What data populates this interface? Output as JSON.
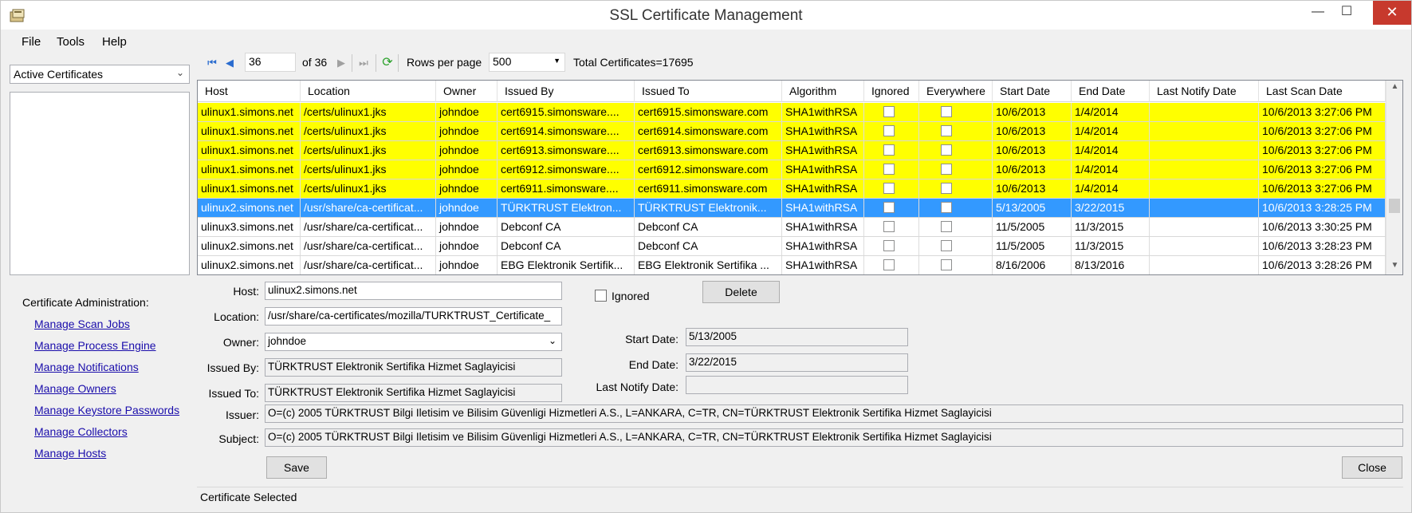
{
  "window": {
    "title": "SSL Certificate Management",
    "min_glyph": "—",
    "max_glyph": "☐",
    "close_glyph": "✕"
  },
  "menu": {
    "file": "File",
    "tools": "Tools",
    "help": "Help"
  },
  "toolbar": {
    "page_value": "36",
    "of_text": "of 36",
    "rows_per_page_label": "Rows per page",
    "rows_per_page_value": "500",
    "total_text": "Total Certificates=17695"
  },
  "sidebar": {
    "filter_value": "Active Certificates",
    "admin_title": "Certificate Administration:",
    "links": [
      "Manage Scan Jobs",
      "Manage Process Engine",
      "Manage Notifications",
      "Manage Owners",
      "Manage Keystore Passwords",
      "Manage Collectors",
      "Manage Hosts"
    ]
  },
  "grid": {
    "columns": [
      "Host",
      "Location",
      "Owner",
      "Issued By",
      "Issued To",
      "Algorithm",
      "Ignored",
      "Everywhere",
      "Start Date",
      "End Date",
      "Last Notify Date",
      "Last Scan Date"
    ],
    "rows": [
      [
        "ulinux1.simons.net",
        "/certs/ulinux1.jks",
        "johndoe",
        "cert6915.simonsware....",
        "cert6915.simonsware.com",
        "SHA1withRSA",
        "",
        "",
        "10/6/2013",
        "1/4/2014",
        "",
        "10/6/2013 3:27:06 PM"
      ],
      [
        "ulinux1.simons.net",
        "/certs/ulinux1.jks",
        "johndoe",
        "cert6914.simonsware....",
        "cert6914.simonsware.com",
        "SHA1withRSA",
        "",
        "",
        "10/6/2013",
        "1/4/2014",
        "",
        "10/6/2013 3:27:06 PM"
      ],
      [
        "ulinux1.simons.net",
        "/certs/ulinux1.jks",
        "johndoe",
        "cert6913.simonsware....",
        "cert6913.simonsware.com",
        "SHA1withRSA",
        "",
        "",
        "10/6/2013",
        "1/4/2014",
        "",
        "10/6/2013 3:27:06 PM"
      ],
      [
        "ulinux1.simons.net",
        "/certs/ulinux1.jks",
        "johndoe",
        "cert6912.simonsware....",
        "cert6912.simonsware.com",
        "SHA1withRSA",
        "",
        "",
        "10/6/2013",
        "1/4/2014",
        "",
        "10/6/2013 3:27:06 PM"
      ],
      [
        "ulinux1.simons.net",
        "/certs/ulinux1.jks",
        "johndoe",
        "cert6911.simonsware....",
        "cert6911.simonsware.com",
        "SHA1withRSA",
        "",
        "",
        "10/6/2013",
        "1/4/2014",
        "",
        "10/6/2013 3:27:06 PM"
      ],
      [
        "ulinux2.simons.net",
        "/usr/share/ca-certificat...",
        "johndoe",
        "TÜRKTRUST Elektron...",
        "TÜRKTRUST Elektronik...",
        "SHA1withRSA",
        "",
        "",
        "5/13/2005",
        "3/22/2015",
        "",
        "10/6/2013 3:28:25 PM"
      ],
      [
        "ulinux3.simons.net",
        "/usr/share/ca-certificat...",
        "johndoe",
        "Debconf CA",
        "Debconf CA",
        "SHA1withRSA",
        "",
        "",
        "11/5/2005",
        "11/3/2015",
        "",
        "10/6/2013 3:30:25 PM"
      ],
      [
        "ulinux2.simons.net",
        "/usr/share/ca-certificat...",
        "johndoe",
        "Debconf CA",
        "Debconf CA",
        "SHA1withRSA",
        "",
        "",
        "11/5/2005",
        "11/3/2015",
        "",
        "10/6/2013 3:28:23 PM"
      ],
      [
        "ulinux2.simons.net",
        "/usr/share/ca-certificat...",
        "johndoe",
        "EBG Elektronik Sertifik...",
        "EBG Elektronik Sertifika ...",
        "SHA1withRSA",
        "",
        "",
        "8/16/2006",
        "8/13/2016",
        "",
        "10/6/2013 3:28:26 PM"
      ]
    ],
    "row_styles": [
      "yellow",
      "yellow",
      "yellow",
      "yellow",
      "yellow",
      "sel",
      "",
      "",
      ""
    ]
  },
  "detail": {
    "host_label": "Host:",
    "host_value": "ulinux2.simons.net",
    "location_label": "Location:",
    "location_value": "/usr/share/ca-certificates/mozilla/TURKTRUST_Certificate_",
    "owner_label": "Owner:",
    "owner_value": "johndoe",
    "issued_by_label": "Issued By:",
    "issued_by_value": "TÜRKTRUST Elektronik Sertifika Hizmet Saglayicisi",
    "issued_to_label": "Issued To:",
    "issued_to_value": "TÜRKTRUST Elektronik Sertifika Hizmet Saglayicisi",
    "ignored_label": "Ignored",
    "delete_label": "Delete",
    "start_date_label": "Start Date:",
    "start_date_value": "5/13/2005",
    "end_date_label": "End Date:",
    "end_date_value": "3/22/2015",
    "last_notify_label": "Last Notify Date:",
    "last_notify_value": "",
    "issuer_label": "Issuer:",
    "issuer_value": "O=(c) 2005 TÜRKTRUST Bilgi Iletisim ve Bilisim Güvenligi Hizmetleri A.S., L=ANKARA, C=TR, CN=TÜRKTRUST Elektronik Sertifika Hizmet Saglayicisi",
    "subject_label": "Subject:",
    "subject_value": "O=(c) 2005 TÜRKTRUST Bilgi Iletisim ve Bilisim Güvenligi Hizmetleri A.S., L=ANKARA, C=TR, CN=TÜRKTRUST Elektronik Sertifika Hizmet Saglayicisi",
    "save_label": "Save",
    "close_label": "Close"
  },
  "status": {
    "text": "Certificate Selected"
  }
}
